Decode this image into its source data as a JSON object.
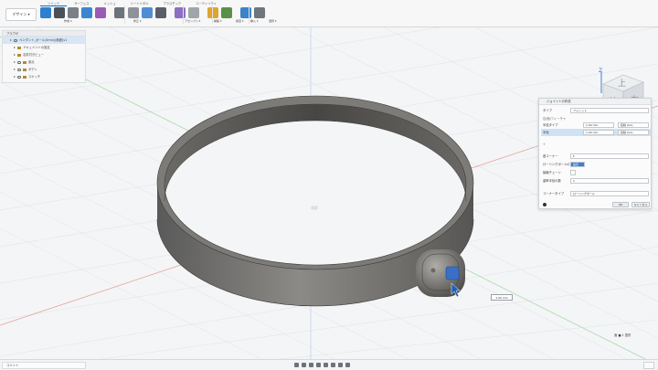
{
  "toolbar": {
    "workspace_label": "デザイン ▾",
    "tabs": [
      {
        "label": "ソリッド",
        "active": true
      },
      {
        "label": "サーフェス",
        "active": false
      },
      {
        "label": "メッシュ",
        "active": false
      },
      {
        "label": "シートメタル",
        "active": false
      },
      {
        "label": "プラスチック",
        "active": false
      },
      {
        "label": "ユーティリティ",
        "active": false
      }
    ],
    "groups": [
      {
        "label": "作成 ▾"
      },
      {
        "label": "修正 ▾"
      },
      {
        "label": "アセンブリ ▾"
      },
      {
        "label": "構築 ▾"
      },
      {
        "label": "検査 ▾"
      },
      {
        "label": "挿入 ▾"
      },
      {
        "label": "選択 ▾"
      }
    ],
    "accent_color": "#0d6ec5"
  },
  "browser": {
    "header": "ブラウザ",
    "items": [
      {
        "label": "ペンダント_ボール(5mm)(無題)v1",
        "selected": true
      },
      {
        "label": "ドキュメントの設定",
        "selected": false
      },
      {
        "label": "名前付きビュー",
        "selected": false
      },
      {
        "label": "原点",
        "selected": false
      },
      {
        "label": "ボディ",
        "selected": false
      },
      {
        "label": "スケッチ",
        "selected": false
      }
    ]
  },
  "dialog": {
    "title": "ジョイントの作成",
    "type_label": "タイプ",
    "type_value": "フィレット",
    "edge_label": "辺/面/フィーチャ",
    "rows": [
      {
        "label": "半径タイプ",
        "value": "1.00 mm",
        "extra": "接線 (G1)"
      },
      {
        "label": "半径",
        "value": "1.00 mm",
        "extra": "接線 (G1)"
      }
    ],
    "add_label": "+",
    "sweep_label": "各コーナー",
    "sweep_value": "▾",
    "rolling_label": "ローリングボールのコーナー",
    "rolling_value": "設定",
    "tangent_label": "接線チェーン",
    "rate_label": "曲率半径の数",
    "rate_value": "1",
    "corner_label": "コーナータイプ",
    "corner_value": "ローリングボール",
    "ok": "OK",
    "cancel": "キャンセル"
  },
  "dimension": {
    "value": "1.00 mm"
  },
  "bottom": {
    "comments": "コメント",
    "corner_text": "面 ■ 1 選択"
  }
}
